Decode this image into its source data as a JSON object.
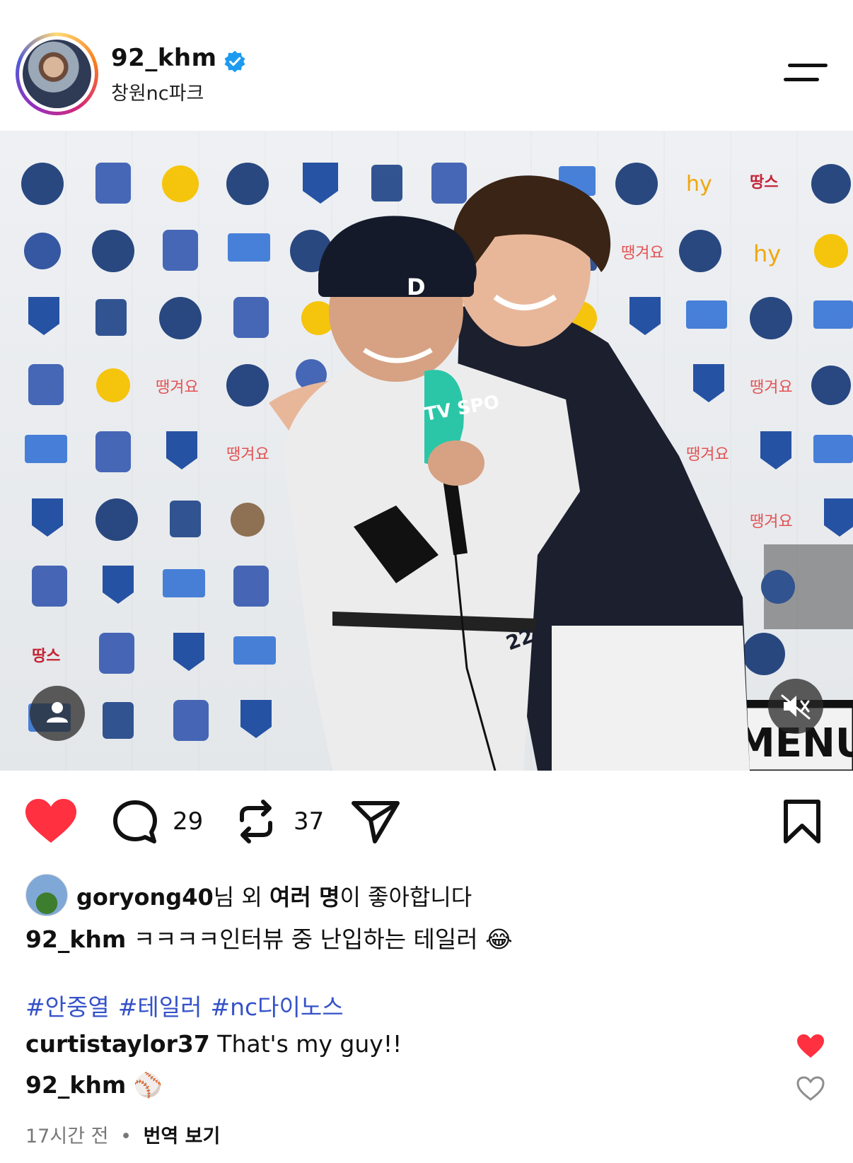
{
  "post": {
    "author": "92_khm",
    "location": "창원nc파크",
    "likes_preview": {
      "user": "goryong40",
      "text_mid": "님 외 ",
      "text_bold": "여러 명",
      "text_end": "이 좋아합니다"
    },
    "comment_count": "29",
    "repost_count": "37",
    "caption_author": "92_khm",
    "caption_text": "ㅋㅋㅋㅋ인터뷰 중 난입하는 테일러 😂",
    "hashtags": [
      "#안중열",
      "#테일러",
      "#nc다이노스"
    ],
    "comments": [
      {
        "user": "curtistaylor37",
        "text": "That's my guy!!",
        "liked": true
      },
      {
        "user": "92_khm",
        "text": "⚾",
        "liked": false
      }
    ],
    "time_ago": "17시간 전",
    "separator": "•",
    "translate_label": "번역 보기",
    "photo_texts": {
      "menu_board": "MENU",
      "mic_label": "TV SPO",
      "jersey_number": "22"
    }
  },
  "icons": {
    "verified": "verified-badge-icon",
    "menu": "hamburger-menu-icon",
    "like": "heart-icon",
    "comment": "comment-bubble-icon",
    "repost": "repost-icon",
    "share": "send-icon",
    "save": "bookmark-icon",
    "tag": "user-tag-icon",
    "mute": "speaker-muted-icon"
  },
  "colors": {
    "like_red": "#ff3040",
    "verified_blue": "#1d9bf0",
    "hashtag_blue": "#3552c9"
  }
}
